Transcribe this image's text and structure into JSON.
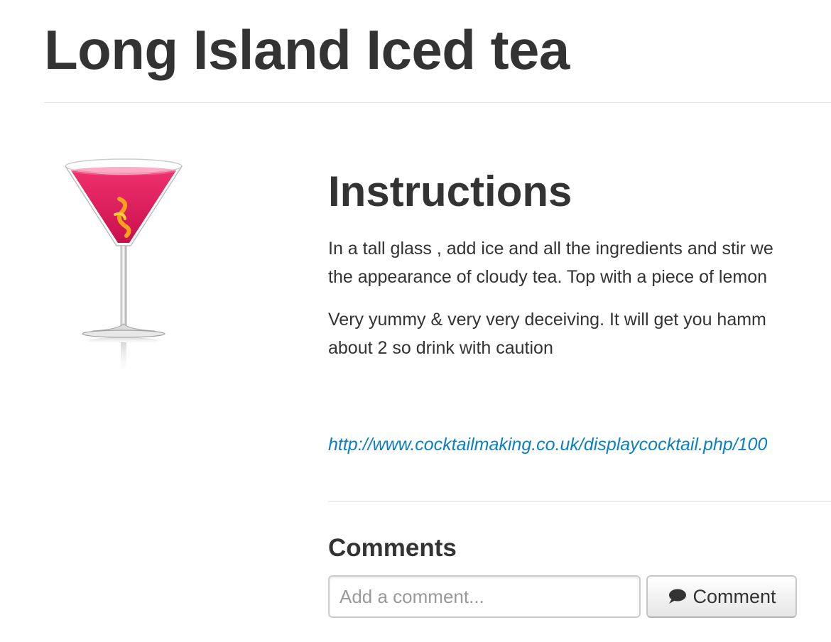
{
  "page": {
    "title": "Long Island Iced tea"
  },
  "image": {
    "icon": "cocktail-glass-image"
  },
  "instructions": {
    "heading": "Instructions",
    "paragraph_1": "In a tall glass , add ice and all the ingredients and stir we\nthe appearance of cloudy tea. Top with a piece of lemon",
    "paragraph_2": "Very yummy & very very deceiving. It will get you hamm\nabout 2 so drink with caution",
    "source_link": "http://www.cocktailmaking.co.uk/displaycocktail.php/100"
  },
  "comments": {
    "heading": "Comments",
    "input_placeholder": "Add a comment...",
    "input_value": "",
    "button_label": "Comment",
    "button_icon": "speech-bubble-icon"
  },
  "colors": {
    "text": "#333333",
    "link": "#0a7fc4",
    "divider": "#e5e5e5",
    "drink": "#e0185a"
  }
}
